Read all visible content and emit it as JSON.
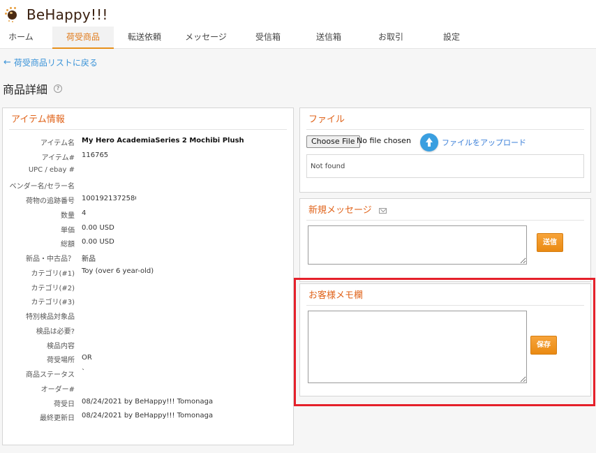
{
  "app": {
    "logo_text": "BeHappy!!!"
  },
  "nav": [
    {
      "label": "ホーム",
      "active": false
    },
    {
      "label": "荷受商品",
      "active": true
    },
    {
      "label": "転送依頼",
      "active": false
    },
    {
      "label": "メッセージ",
      "active": false
    },
    {
      "label": "受信箱",
      "active": false
    },
    {
      "label": "送信箱",
      "active": false
    },
    {
      "label": "お取引",
      "active": false
    },
    {
      "label": "設定",
      "active": false
    }
  ],
  "back_link": {
    "label": "荷受商品リストに戻る"
  },
  "page": {
    "title": "商品詳細",
    "help_icon": "question-circle-icon"
  },
  "item_panel": {
    "title": "アイテム情報",
    "rows": [
      {
        "label": "アイテム名",
        "value": "My Hero AcademiaSeries 2 Mochibi Plush",
        "bold": true
      },
      {
        "label": "アイテム#",
        "value": "116765"
      },
      {
        "label": "UPC / ebay #",
        "value": ""
      },
      {
        "label": "ベンダー名/セラー名",
        "value": ""
      },
      {
        "label": "荷物の追跡番号",
        "value": "1001921372580("
      },
      {
        "label": "数量",
        "value": "4"
      },
      {
        "label": "単価",
        "value": "0.00 USD"
      },
      {
        "label": "総額",
        "value": "0.00 USD"
      },
      {
        "label": "新品・中古品？",
        "value": "新品"
      },
      {
        "label": "カテゴリ(#1)",
        "value": "Toy (over 6 year-old)"
      },
      {
        "label": "カテゴリ(#2)",
        "value": ""
      },
      {
        "label": "カテゴリ(#3)",
        "value": ""
      },
      {
        "label": "特別検品対象品",
        "value": ""
      },
      {
        "label": "検品は必要?",
        "value": ""
      },
      {
        "label": "検品内容",
        "value": ""
      },
      {
        "label": "荷受場所",
        "value": "OR"
      },
      {
        "label": "商品ステータス",
        "value": "`"
      },
      {
        "label": "オーダー#",
        "value": ""
      },
      {
        "label": "荷受日",
        "value": "08/24/2021 by BeHappy!!! Tomonaga"
      },
      {
        "label": "最終更新日",
        "value": "08/24/2021 by BeHappy!!! Tomonaga"
      }
    ]
  },
  "file_panel": {
    "title": "ファイル",
    "choose_label": "Choose File",
    "no_file_label": "No file chosen",
    "upload_label": "ファイルをアップロード",
    "list_text": "Not found"
  },
  "message_panel": {
    "title": "新規メッセージ",
    "icon": "envelope-icon",
    "textarea_value": "",
    "send_label": "送信"
  },
  "memo_panel": {
    "title": "お客様メモ欄",
    "textarea_value": "",
    "save_label": "保存"
  },
  "colors": {
    "accent_orange": "#e0631a",
    "button_orange": "#ea8a12",
    "link_blue": "#3a93d8",
    "highlight_red": "#e5202a"
  }
}
